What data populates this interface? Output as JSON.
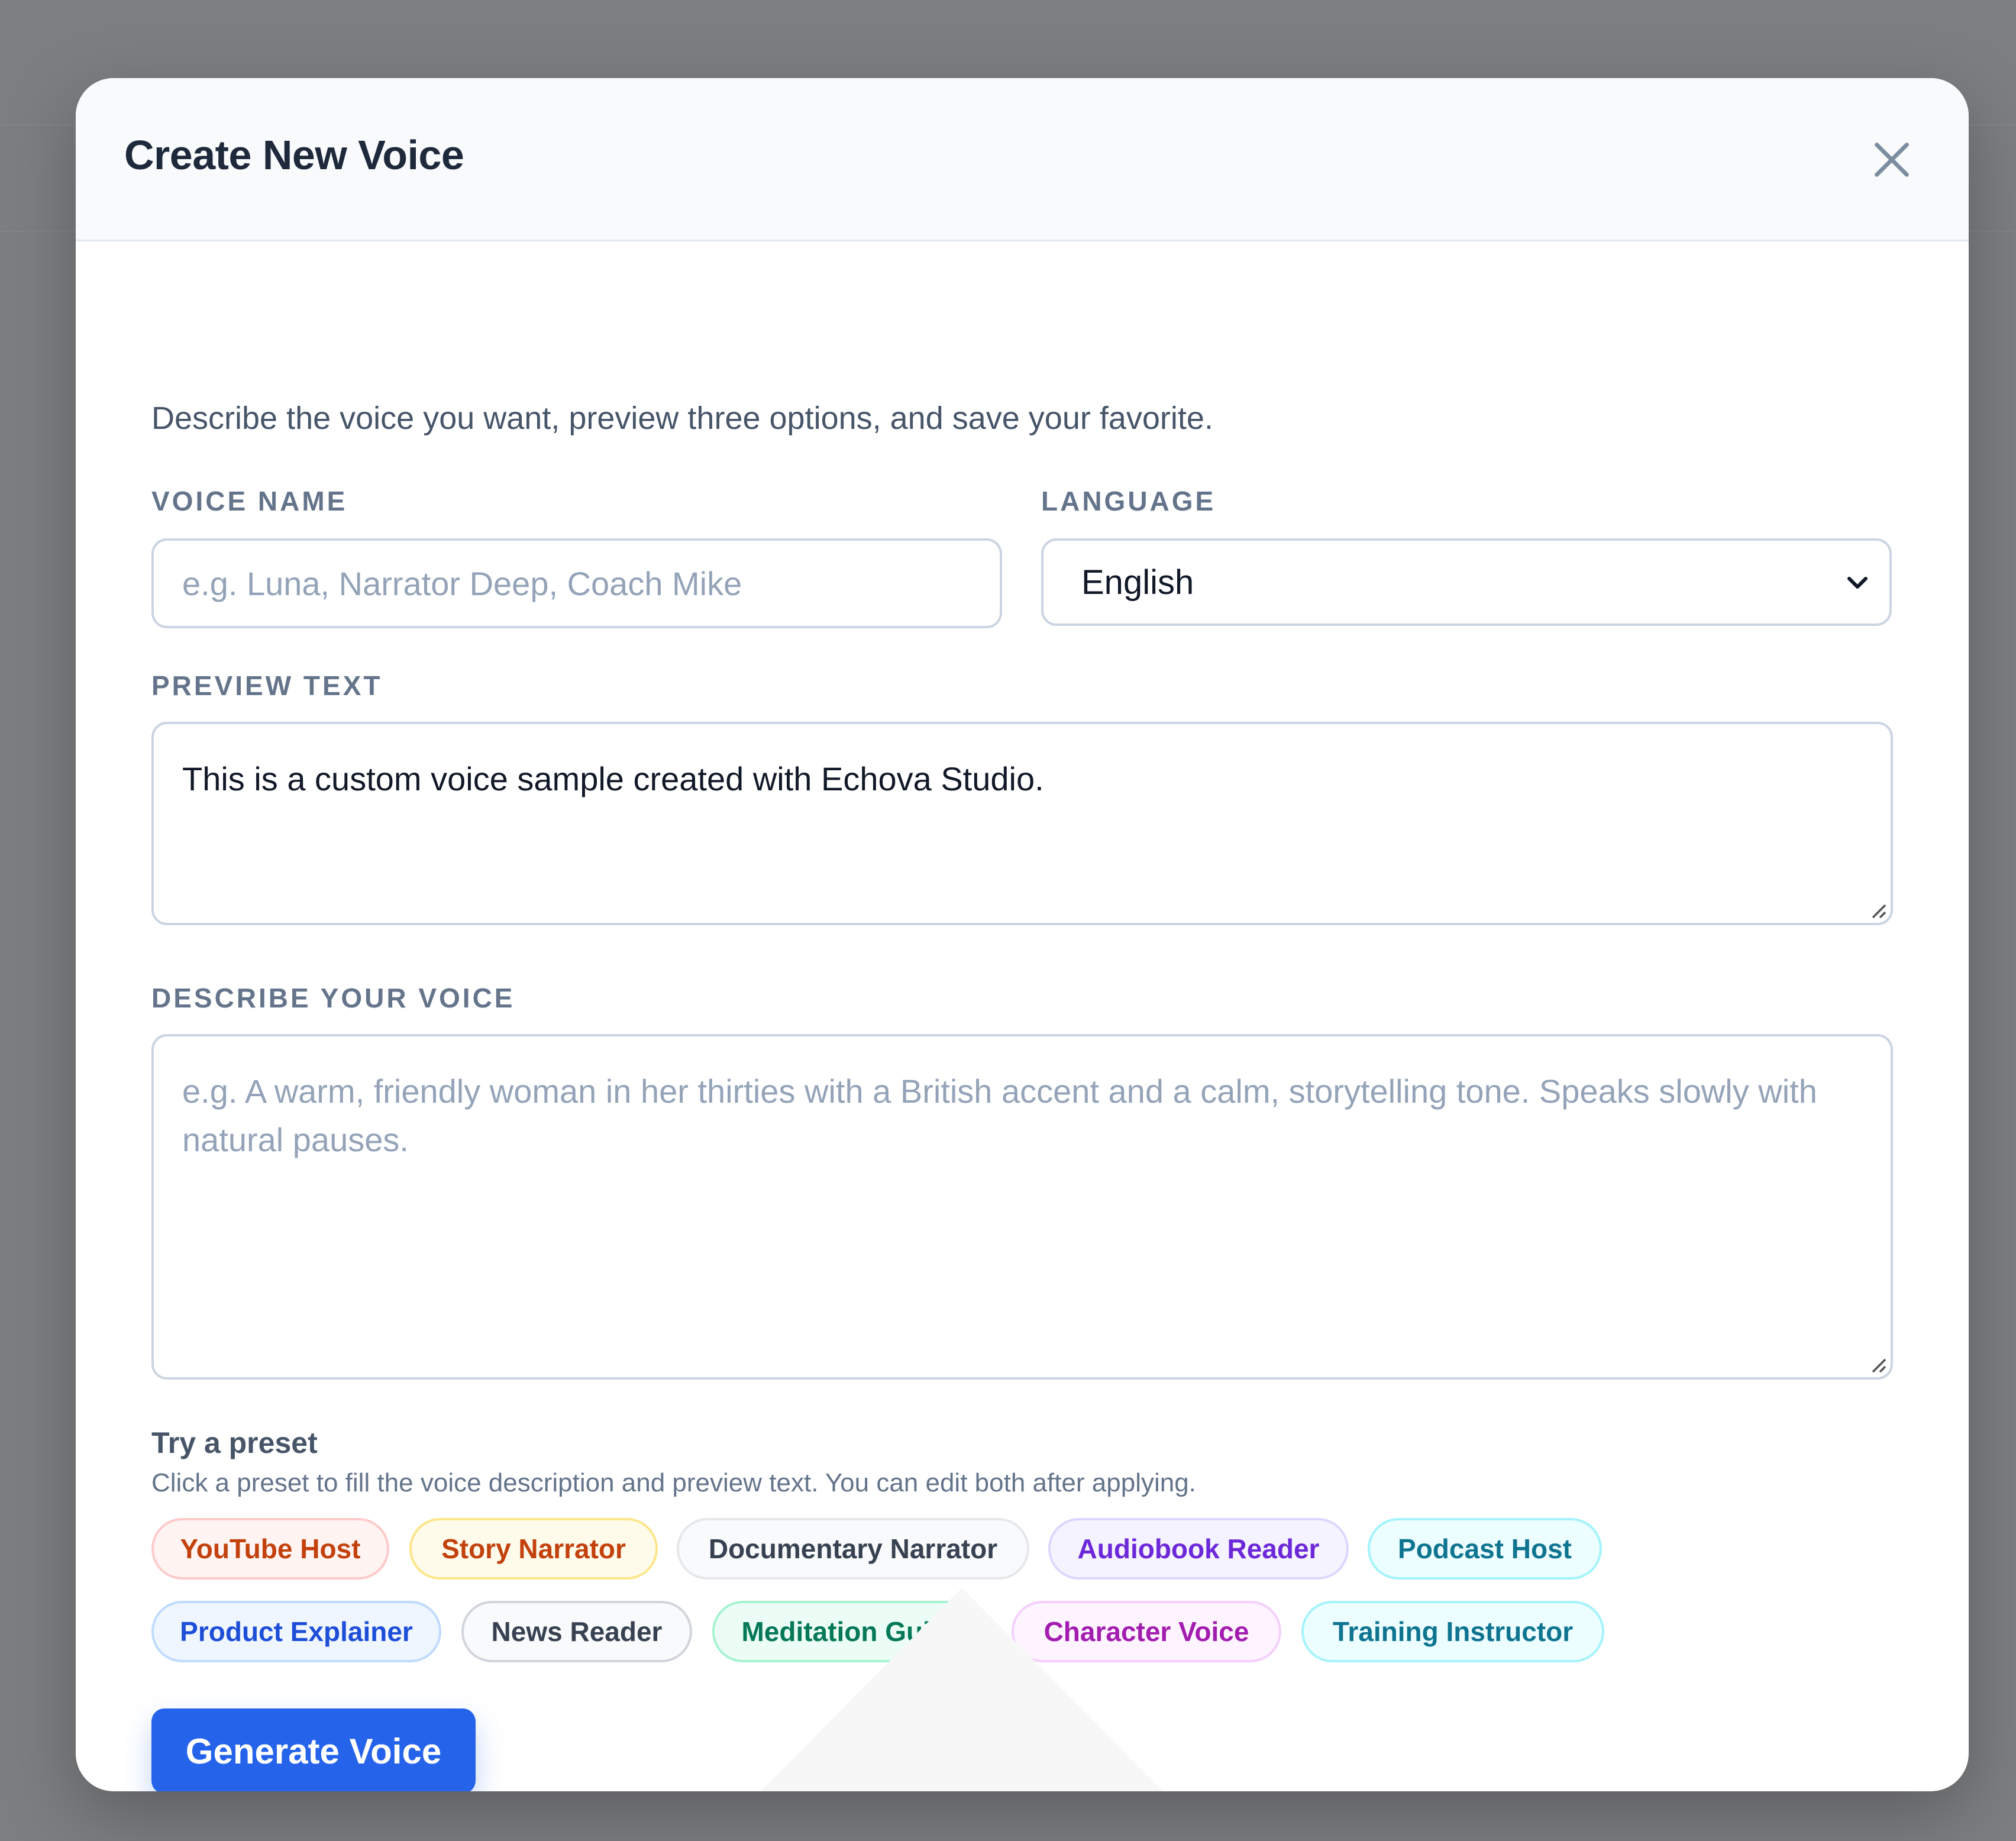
{
  "modal": {
    "title": "Create New Voice",
    "intro": "Describe the voice you want, preview three options, and save your favorite."
  },
  "form": {
    "voice_name": {
      "label": "VOICE NAME",
      "value": "",
      "placeholder": "e.g. Luna, Narrator Deep, Coach Mike"
    },
    "language": {
      "label": "LANGUAGE",
      "selected": "English"
    },
    "preview_text": {
      "label": "PREVIEW TEXT",
      "value": "This is a custom voice sample created with Echova Studio."
    },
    "describe_voice": {
      "label": "DESCRIBE YOUR VOICE",
      "placeholder": "e.g. A warm, friendly woman in her thirties with a British accent and a calm, storytelling tone. Speaks slowly with natural pauses."
    }
  },
  "presets": {
    "title": "Try a preset",
    "help": "Click a preset to fill the voice description and preview text. You can edit both after applying.",
    "items": [
      {
        "label": "YouTube Host",
        "text": "#c2410c",
        "bg": "#fff4f2",
        "border": "#fecaca"
      },
      {
        "label": "Story Narrator",
        "text": "#c2410c",
        "bg": "#fffbeb",
        "border": "#fde68a"
      },
      {
        "label": "Documentary Narrator",
        "text": "#374151",
        "bg": "#f9fafb",
        "border": "#e5e7eb"
      },
      {
        "label": "Audiobook Reader",
        "text": "#6d28d9",
        "bg": "#f5f3ff",
        "border": "#ddd6fe"
      },
      {
        "label": "Podcast Host",
        "text": "#0e7490",
        "bg": "#ecfeff",
        "border": "#a5f3fc"
      },
      {
        "label": "Product Explainer",
        "text": "#1d4ed8",
        "bg": "#eff6ff",
        "border": "#bfdbfe"
      },
      {
        "label": "News Reader",
        "text": "#374151",
        "bg": "#f9fafb",
        "border": "#d1d5db"
      },
      {
        "label": "Meditation Guide",
        "text": "#047857",
        "bg": "#ecfdf5",
        "border": "#a7f3d0"
      },
      {
        "label": "Character Voice",
        "text": "#a21caf",
        "bg": "#fdf4ff",
        "border": "#f5d0fe"
      },
      {
        "label": "Training Instructor",
        "text": "#0e7490",
        "bg": "#ecfeff",
        "border": "#a5f3fc"
      }
    ]
  },
  "actions": {
    "generate_label": "Generate Voice"
  },
  "icons": {
    "close": "close-icon",
    "chevron": "chevron-down-icon",
    "grip": "resize-grip-icon"
  },
  "colors": {
    "accent": "#2563eb",
    "title": "#1e293b",
    "label": "#64748b"
  }
}
